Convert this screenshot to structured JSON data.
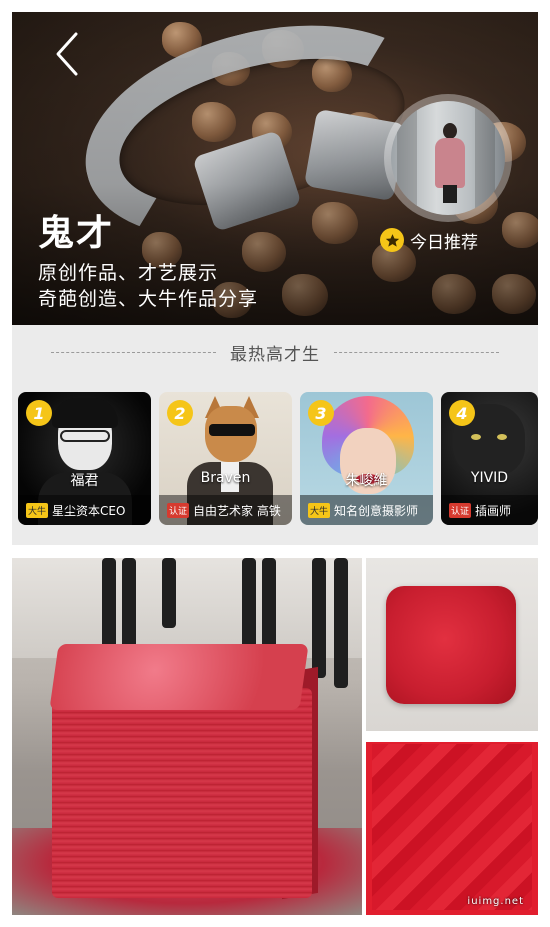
{
  "hero": {
    "title": "鬼才",
    "subtitle_line1": "原创作品、才艺展示",
    "subtitle_line2": "奇葩创造、大牛作品分享",
    "today_label": "今日推荐",
    "back_icon": "chevron-left-icon",
    "star_icon": "star-icon"
  },
  "section": {
    "title": "最热高才生"
  },
  "cards": [
    {
      "rank": "1",
      "name": "福君",
      "badge": "大牛",
      "badge_color": "#f5c518",
      "desc": "星尘资本CEO"
    },
    {
      "rank": "2",
      "name": "Braven",
      "badge": "认证",
      "badge_color": "#d63a2f",
      "desc": "自由艺术家 高铁"
    },
    {
      "rank": "3",
      "name": "朱峻維",
      "badge": "大牛",
      "badge_color": "#f5c518",
      "desc": "知名创意摄影师"
    },
    {
      "rank": "4",
      "name": "YIVID",
      "badge": "认证",
      "badge_color": "#d63a2f",
      "desc": "插画师"
    }
  ],
  "watermark": "iuimg.net",
  "colors": {
    "accent": "#f5c518",
    "section_bg": "#ebebeb",
    "artwork_red": "#d6394b"
  }
}
